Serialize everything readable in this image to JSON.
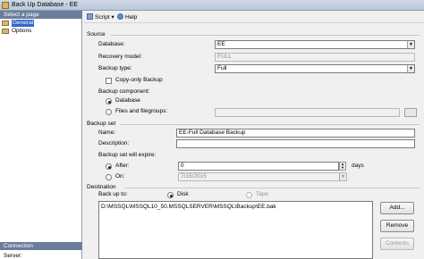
{
  "window": {
    "title": "Back Up Database - EE"
  },
  "left_panel": {
    "header": "Select a page",
    "items": [
      {
        "label": "General",
        "selected": true
      },
      {
        "label": "Options",
        "selected": false
      }
    ],
    "connection_header": "Connection",
    "server_label": "Server:"
  },
  "toolbar": {
    "script_label": "Script",
    "help_label": "Help"
  },
  "source": {
    "section_label": "Source",
    "database_label": "Database:",
    "database_value": "EE",
    "recovery_label": "Recovery model:",
    "recovery_value": "FULL",
    "backup_type_label": "Backup type:",
    "backup_type_value": "Full",
    "copy_only_label": "Copy-only Backup",
    "component_label": "Backup component:",
    "database_option": "Database",
    "files_option": "Files and filegroups:"
  },
  "backup_set": {
    "section_label": "Backup set",
    "name_label": "Name:",
    "name_value": "EE-Full Database Backup",
    "description_label": "Description:",
    "description_value": "",
    "expire_label": "Backup set will expire:",
    "after_label": "After:",
    "after_value": "0",
    "days_label": "days",
    "on_label": "On:",
    "on_value": "7/15/2015"
  },
  "destination": {
    "section_label": "Destination",
    "backup_to_label": "Back up to:",
    "disk_label": "Disk",
    "tape_label": "Tape",
    "paths": [
      "D:\\MSSQL\\MSSQL10_50.MSSQLSERVER\\MSSQL\\Backup\\EE.bak"
    ],
    "add_button": "Add...",
    "remove_button": "Remove",
    "contents_button": "Contents"
  }
}
